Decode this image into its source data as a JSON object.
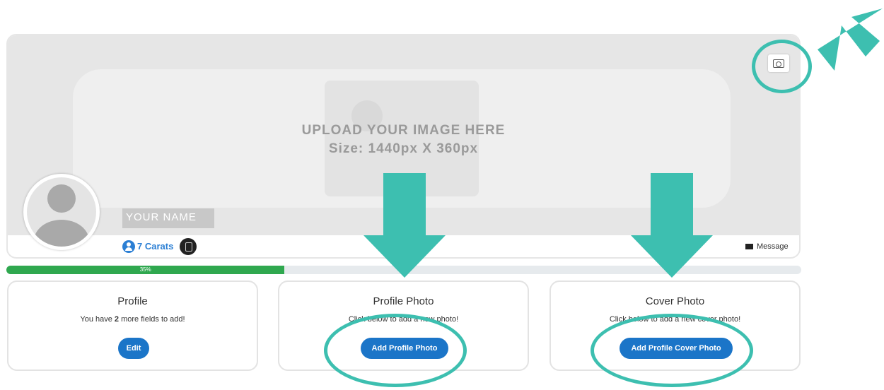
{
  "cover": {
    "upload_title": "UPLOAD YOUR IMAGE HERE",
    "upload_size": "Size: 1440px X 360px",
    "camera_icon": "camera-icon"
  },
  "profile": {
    "name": "YOUR NAME",
    "carats_label": "7 Carats",
    "message_label": "Message"
  },
  "progress": {
    "percent": 35,
    "label": "35%",
    "fill_color": "#2fa84f",
    "track_color": "#e6eaed"
  },
  "cards": {
    "profile": {
      "title": "Profile",
      "desc_prefix": "You have ",
      "desc_count": "2",
      "desc_suffix": " more fields to add!",
      "button": "Edit"
    },
    "profile_photo": {
      "title": "Profile Photo",
      "desc": "Click below to add a new photo!",
      "button": "Add Profile Photo"
    },
    "cover_photo": {
      "title": "Cover Photo",
      "desc": "Click below to add a new cover photo!",
      "button": "Add Profile Cover Photo"
    }
  },
  "colors": {
    "accent_button": "#1b75c8",
    "annotation": "#3dbfb0",
    "link_blue": "#2b7fd4"
  }
}
